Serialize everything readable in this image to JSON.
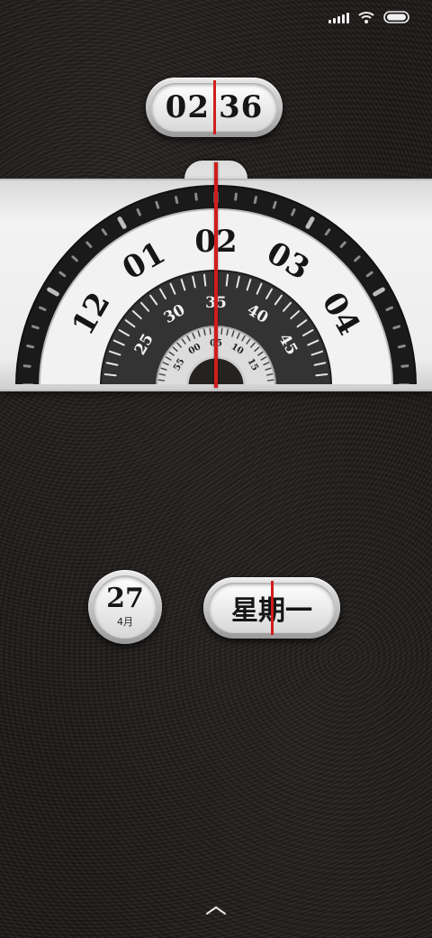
{
  "status_bar": {
    "icons": [
      "signal-icon",
      "wifi-icon",
      "battery-icon"
    ]
  },
  "clock": {
    "hour": "02",
    "minute": "36"
  },
  "dial": {
    "hour_labels": [
      "12",
      "01",
      "02",
      "03",
      "04"
    ],
    "minute_labels": [
      "25",
      "30",
      "35",
      "40",
      "45"
    ],
    "second_labels": [
      "55",
      "00",
      "05",
      "10",
      "15"
    ],
    "accent_color": "#d01c1c"
  },
  "date": {
    "day": "27",
    "month": "4月",
    "weekday": "星期一"
  },
  "colors": {
    "background": "#221e1c",
    "pointer": "#d01c1c",
    "bezel": "#2a2a2a",
    "face": "#f2f2f2"
  },
  "nav": {
    "icon": "chevron-up-icon"
  }
}
